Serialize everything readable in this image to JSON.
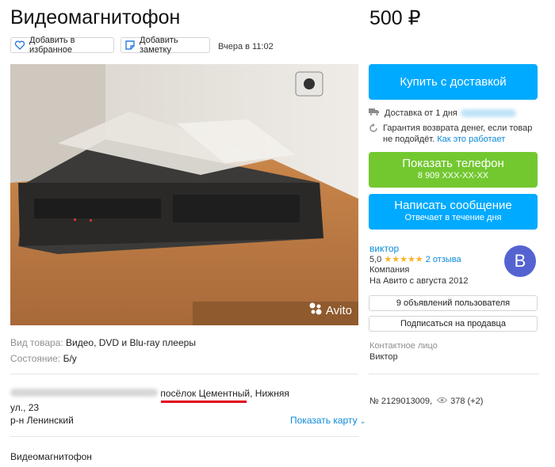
{
  "listing": {
    "title": "Видеомагнитофон",
    "price": "500 ₽",
    "favorite_label": "Добавить в избранное",
    "note_label": "Добавить заметку",
    "posted": "Вчера в 11:02",
    "watermark": "Avito",
    "item_type_label": "Вид товара:",
    "item_type_value": "Видео, DVD и Blu-ray плееры",
    "condition_label": "Состояние:",
    "condition_value": "Б/у",
    "address_visible": "посёлок Цементный, Нижняя",
    "address_line2": "ул., 23",
    "district": "р-н Ленинский",
    "show_map": "Показать карту",
    "description": "Видеомагнитофон",
    "id_text": "№ 2129013009,",
    "views": "378 (+2)"
  },
  "sidebar": {
    "buy_delivery": "Купить с доставкой",
    "delivery_text": "Доставка от 1 дня",
    "guarantee_line1": "Гарантия возврата денег, если товар",
    "guarantee_line2": "не подойдёт.",
    "guarantee_link": "Как это работает",
    "show_phone": "Показать телефон",
    "phone_masked": "8 909 XXX-XX-XX",
    "write_message": "Написать сообщение",
    "reply_time": "Отвечает в течение дня",
    "seller_name": "виктор",
    "rating": "5,0",
    "stars": "★★★★★",
    "reviews": "2 отзыва",
    "seller_type": "Компания",
    "seller_since": "На Авито с августа 2012",
    "avatar_letter": "В",
    "user_listings": "9 объявлений пользователя",
    "subscribe": "Подписаться на продавца",
    "contact_label": "Контактное лицо",
    "contact_name": "Виктор"
  },
  "colors": {
    "accent_blue": "#00aaff",
    "accent_green": "#73c830",
    "link": "#0a8ad8",
    "avatar": "#5563d1",
    "underline": "#e0001a"
  }
}
